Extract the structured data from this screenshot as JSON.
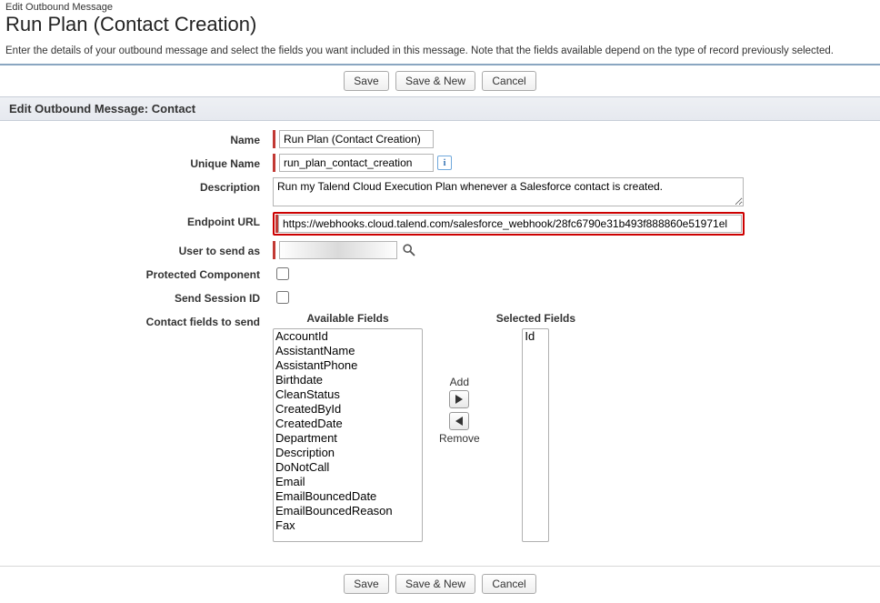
{
  "header": {
    "section_label": "Edit Outbound Message",
    "title": "Run Plan (Contact Creation)"
  },
  "instructions": "Enter the details of your outbound message and select the fields you want included in this message. Note that the fields available depend on the type of record previously selected.",
  "buttons": {
    "save": "Save",
    "save_and_new": "Save & New",
    "cancel": "Cancel"
  },
  "section": {
    "prefix": "Edit Outbound Message:",
    "object": "Contact"
  },
  "form": {
    "name_label": "Name",
    "name_value": "Run Plan (Contact Creation)",
    "unique_label": "Unique Name",
    "unique_value": "run_plan_contact_creation",
    "description_label": "Description",
    "description_value": "Run my Talend Cloud Execution Plan whenever a Salesforce contact is created.",
    "endpoint_label": "Endpoint URL",
    "endpoint_value": "https://webhooks.cloud.talend.com/salesforce_webhook/28fc6790e31b493f888860e51971el",
    "user_label": "User to send as",
    "user_value": "",
    "protected_label": "Protected Component",
    "session_label": "Send Session ID",
    "contact_fields_label": "Contact fields to send"
  },
  "dual_list": {
    "available_caption": "Available Fields",
    "selected_caption": "Selected Fields",
    "add_label": "Add",
    "remove_label": "Remove",
    "available": [
      "AccountId",
      "AssistantName",
      "AssistantPhone",
      "Birthdate",
      "CleanStatus",
      "CreatedById",
      "CreatedDate",
      "Department",
      "Description",
      "DoNotCall",
      "Email",
      "EmailBouncedDate",
      "EmailBouncedReason",
      "Fax"
    ],
    "selected": [
      "Id"
    ]
  },
  "icons": {
    "info": "i"
  }
}
